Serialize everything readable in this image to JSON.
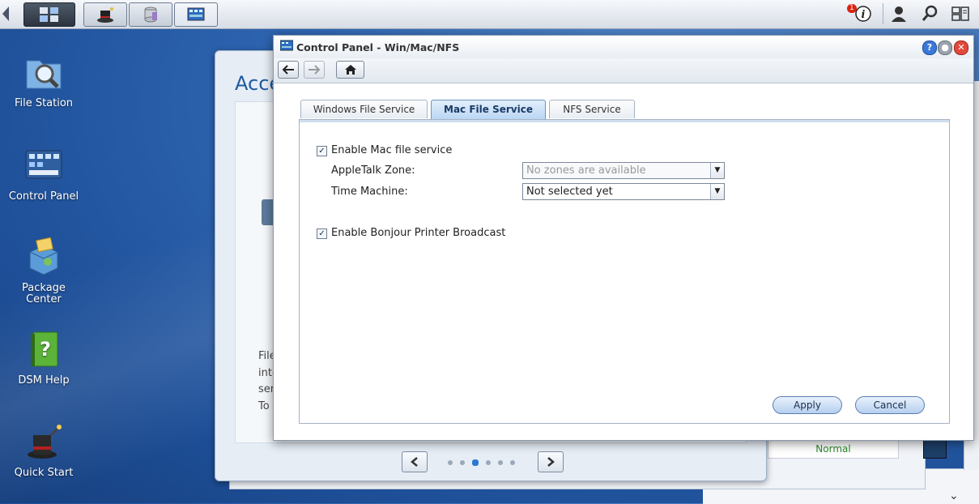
{
  "desktop": {
    "icons": [
      {
        "label_line1": "File Station",
        "label_line2": ""
      },
      {
        "label_line1": "Control Panel",
        "label_line2": ""
      },
      {
        "label_line1": "Package",
        "label_line2": "Center"
      },
      {
        "label_line1": "DSM Help",
        "label_line2": ""
      },
      {
        "label_line1": "Quick Start",
        "label_line2": ""
      }
    ]
  },
  "taskbar": {
    "notification_count": "1"
  },
  "background_window": {
    "title": "Acce",
    "text_lines": [
      "File",
      "inte",
      "ser",
      "To"
    ],
    "status_text": "Normal"
  },
  "dialog": {
    "title": "Control Panel - Win/Mac/NFS",
    "tabs": [
      "Windows File Service",
      "Mac File Service",
      "NFS Service"
    ],
    "active_tab": "Mac File Service",
    "enable_mac": {
      "label": "Enable Mac file service",
      "checked": true
    },
    "appletalk": {
      "label": "AppleTalk Zone:",
      "value": "No zones are available"
    },
    "time_machine": {
      "label": "Time Machine:",
      "value": "Not selected yet"
    },
    "bonjour": {
      "label": "Enable Bonjour Printer Broadcast",
      "checked": true
    },
    "apply_label": "Apply",
    "cancel_label": "Cancel"
  },
  "colors": {
    "accent": "#2a78d4",
    "desktop_bg": "#2f66b2",
    "status_green": "#2a8a2a"
  }
}
